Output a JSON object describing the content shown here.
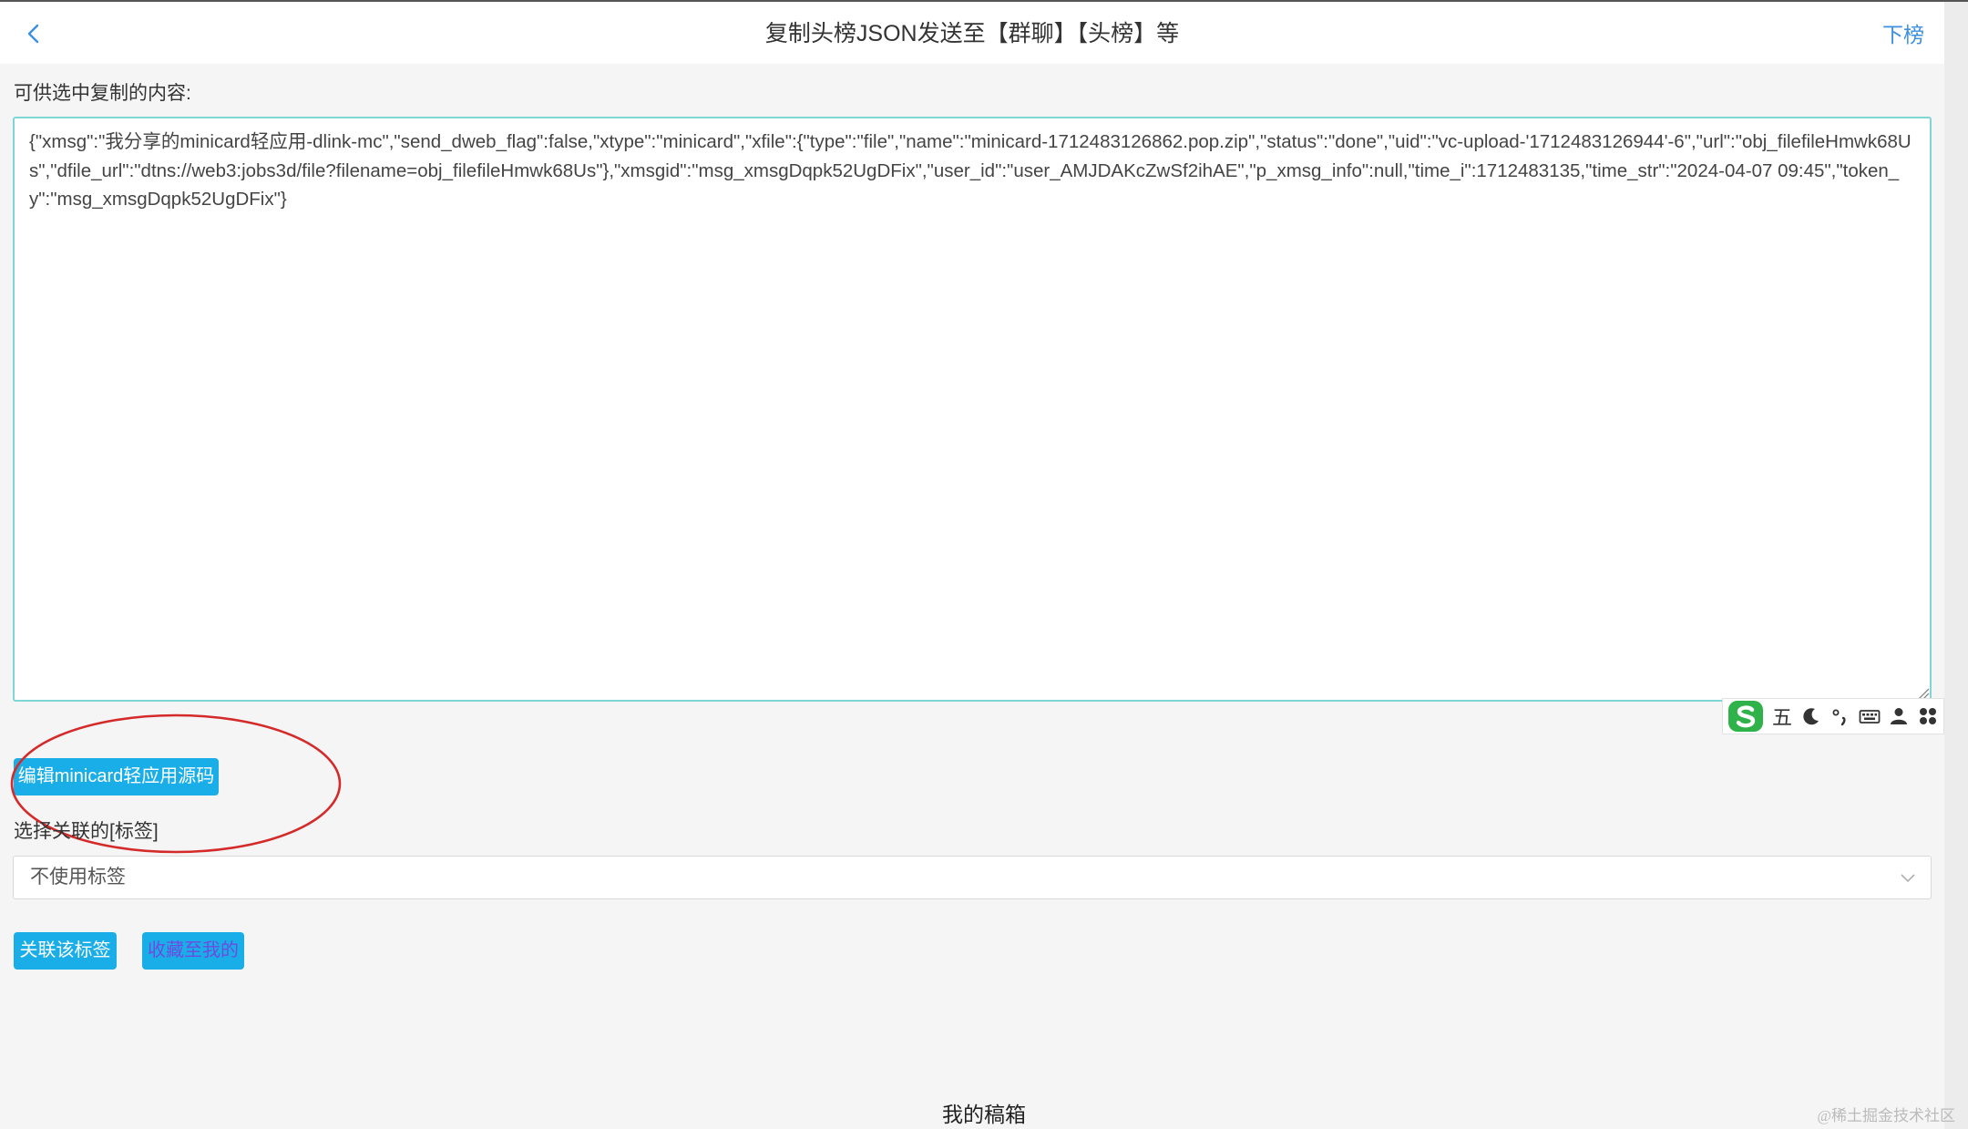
{
  "header": {
    "title": "复制头榜JSON发送至【群聊】【头榜】等",
    "right_link": "下榜",
    "back_icon": "chevron-left-icon"
  },
  "content": {
    "copy_label": "可供选中复制的内容:",
    "json_text": "{\"xmsg\":\"我分享的minicard轻应用-dlink-mc\",\"send_dweb_flag\":false,\"xtype\":\"minicard\",\"xfile\":{\"type\":\"file\",\"name\":\"minicard-1712483126862.pop.zip\",\"status\":\"done\",\"uid\":\"vc-upload-'1712483126944'-6\",\"url\":\"obj_filefileHmwk68Us\",\"dfile_url\":\"dtns://web3:jobs3d/file?filename=obj_filefileHmwk68Us\"},\"xmsgid\":\"msg_xmsgDqpk52UgDFix\",\"user_id\":\"user_AMJDAKcZwSf2ihAE\",\"p_xmsg_info\":null,\"time_i\":1712483135,\"time_str\":\"2024-04-07 09:45\",\"token_y\":\"msg_xmsgDqpk52UgDFix\"}"
  },
  "ime_toolbar": {
    "logo_icon": "sogou-s-icon",
    "mode_label": "五",
    "items": [
      "moon-icon",
      "punctuation-icon",
      "keyboard-icon",
      "user-icon",
      "apps-icon"
    ]
  },
  "actions": {
    "edit_source_label": "编辑minicard轻应用源码"
  },
  "tags": {
    "label": "选择关联的[标签]",
    "selected": "不使用标签"
  },
  "buttons": {
    "link_tag_label": "关联该标签",
    "favorite_label": "收藏至我的"
  },
  "footer": {
    "drafts_label": "我的稿箱"
  },
  "watermark": "@稀土掘金技术社区",
  "colors": {
    "accent": "#1aaee8",
    "link": "#3d8fe0",
    "textarea_border": "#7fd6d6",
    "annotation": "#d42a2a"
  }
}
